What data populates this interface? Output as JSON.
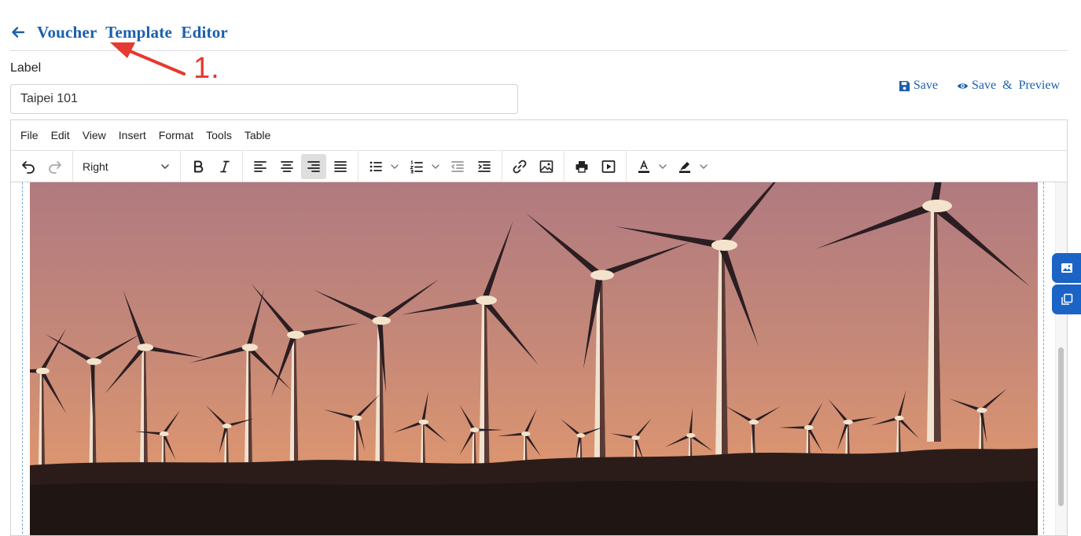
{
  "header": {
    "title": "Voucher Template Editor"
  },
  "annotation": {
    "label": "1."
  },
  "form": {
    "label_caption": "Label",
    "label_value": "Taipei 101"
  },
  "actions": {
    "save_label": "Save",
    "save_preview_label": "Save & Preview"
  },
  "editor": {
    "menu": [
      "File",
      "Edit",
      "View",
      "Insert",
      "Format",
      "Tools",
      "Table"
    ],
    "toolbar": {
      "alignment_selected": "Right",
      "active_button": "align-right"
    }
  },
  "colors": {
    "accent": "#1b5fae",
    "annotation": "#e6392f",
    "side_tab": "#1b64c6"
  },
  "icons": [
    "back-arrow-icon",
    "save-icon",
    "eye-icon",
    "undo-icon",
    "redo-icon",
    "bold-icon",
    "italic-icon",
    "align-left-icon",
    "align-center-icon",
    "align-right-icon",
    "align-justify-icon",
    "bullet-list-icon",
    "numbered-list-icon",
    "outdent-icon",
    "indent-icon",
    "link-icon",
    "image-icon",
    "print-icon",
    "media-icon",
    "text-color-icon",
    "highlight-icon",
    "image-panel-icon",
    "copy-panel-icon"
  ]
}
